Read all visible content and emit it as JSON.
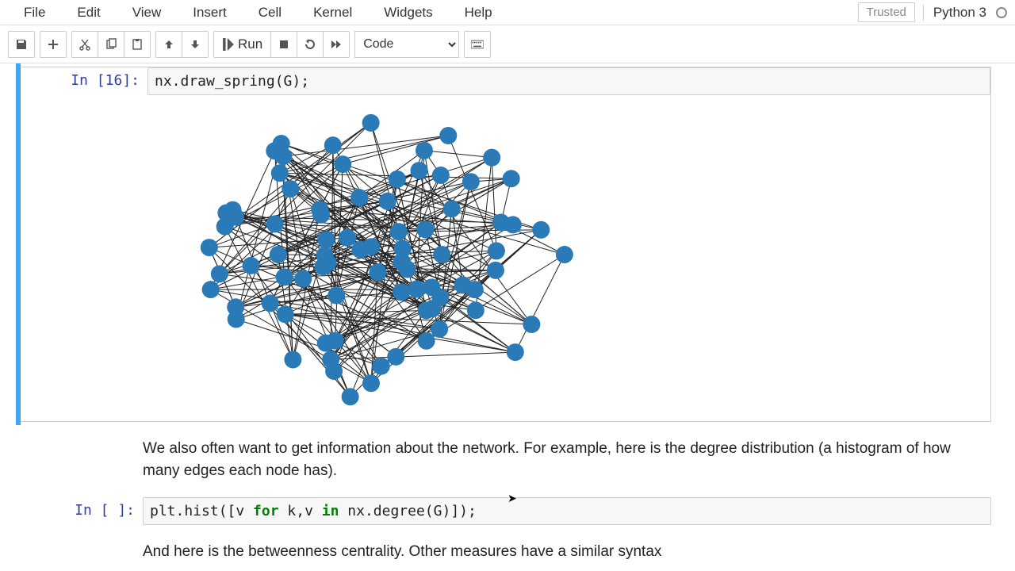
{
  "menus": [
    "File",
    "Edit",
    "View",
    "Insert",
    "Cell",
    "Kernel",
    "Widgets",
    "Help"
  ],
  "trusted_label": "Trusted",
  "kernel_name": "Python 3",
  "toolbar": {
    "run_label": "Run",
    "cell_type": "Code"
  },
  "cells": {
    "c16": {
      "prompt": "In [16]:",
      "code": "nx.draw_spring(G);"
    },
    "md1": "We also often want to get information about the network. For example, here is the degree distribution (a histogram of how many edges each node has).",
    "c_hist": {
      "prompt": "In [ ]:",
      "code_pre": "plt.hist([v ",
      "kw_for": "for",
      "code_mid": " k,v ",
      "kw_in": "in",
      "code_post": " nx.degree(G)]);"
    },
    "md2": "And here is the betweenness centrality. Other measures have a similar syntax"
  }
}
